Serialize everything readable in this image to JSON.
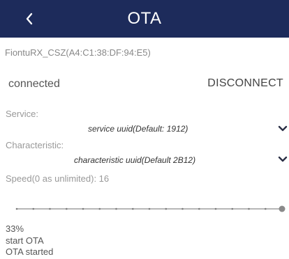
{
  "appbar": {
    "title": "OTA",
    "back_icon": "chevron-left-icon"
  },
  "device": {
    "name": "FiontuRX_CSZ(A4:C1:38:DF:94:E5)"
  },
  "connection": {
    "status": "connected",
    "disconnect_label": "DISCONNECT"
  },
  "service": {
    "label": "Service:",
    "value": "service uuid(Default: 1912)",
    "dropdown_icon": "chevron-down-icon"
  },
  "characteristic": {
    "label": "Characteristic:",
    "value": "characteristic uuid(Default 2B12)",
    "dropdown_icon": "chevron-down-icon"
  },
  "speed": {
    "label": "Speed(0 as unlimited): 16",
    "slider_fraction": 1.0
  },
  "log": {
    "progress": "33%",
    "line1": "start OTA",
    "line2": "OTA started"
  },
  "colors": {
    "appbar": "#1d2b5b",
    "appbar_text": "#ffffff",
    "slider_track": "#9e9e9e",
    "slider_thumb": "#8a8a8a"
  }
}
